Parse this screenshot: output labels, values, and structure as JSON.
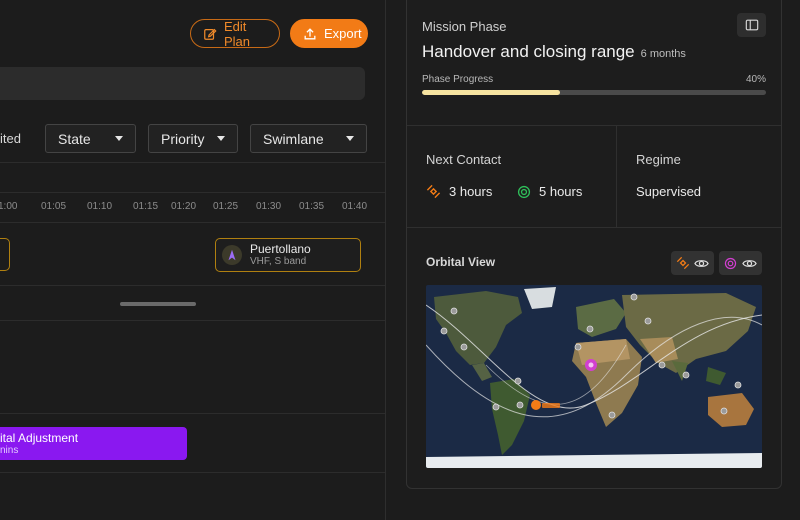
{
  "header": {
    "edit_label": "Edit Plan",
    "export_label": "Export"
  },
  "filters": {
    "partial_label": "ited",
    "state": "State",
    "priority": "Priority",
    "swimlane": "Swimlane"
  },
  "timeline": {
    "ticks": [
      "1:00",
      "01:05",
      "01:10",
      "01:15",
      "01:20",
      "01:25",
      "01:30",
      "01:35",
      "01:40"
    ],
    "station": {
      "name": "Puertollano",
      "bands": "VHF, S band"
    },
    "task": {
      "title": "ital Adjustment",
      "subtitle": "nins"
    }
  },
  "mission_phase": {
    "label": "Mission Phase",
    "title": "Handover and closing range",
    "duration": "6 months",
    "progress_label": "Phase Progress",
    "progress_text": "40%",
    "progress": 0.4
  },
  "next_contact": {
    "label": "Next Contact",
    "primary": "3 hours",
    "secondary": "5 hours"
  },
  "regime": {
    "label": "Regime",
    "value": "Supervised"
  },
  "orbital_view": {
    "label": "Orbital View"
  },
  "colors": {
    "accent": "#f27b16",
    "purple": "#8a18f0",
    "green": "#2fbf5a",
    "magenta": "#d23fd0",
    "progress": "#f6e3a0"
  }
}
